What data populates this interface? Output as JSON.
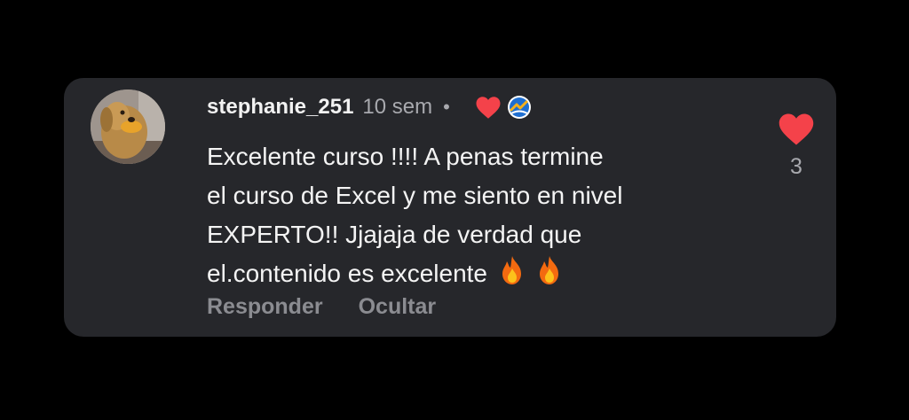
{
  "comment": {
    "username": "stephanie_251",
    "timestamp": "10 sem",
    "separator": "•",
    "body_lines": [
      "Excelente curso !!!! A penas termine",
      "el curso de Excel y me siento en nivel",
      "EXPERTO!! Jjajaja de verdad que",
      "el.contenido es excelente"
    ],
    "emoji": [
      "fire-icon",
      "fire-icon"
    ],
    "author_reactions": [
      "heart-icon",
      "creator-badge-icon"
    ],
    "like_count": "3",
    "actions": {
      "reply_label": "Responder",
      "hide_label": "Ocultar"
    }
  },
  "colors": {
    "card_background": "#26272b",
    "heart": "#f4424a",
    "username": "#f2f2f2",
    "muted_text": "#a8a9ae",
    "action_text": "#8b8c91"
  }
}
